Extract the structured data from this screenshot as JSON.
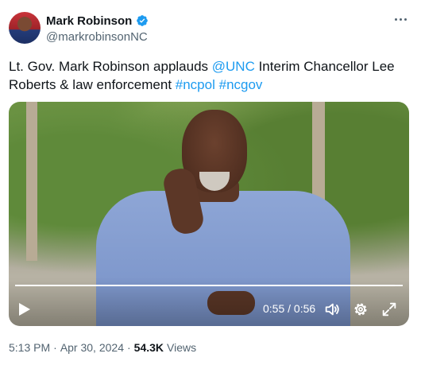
{
  "author": {
    "name": "Mark Robinson",
    "handle": "@markrobinsonNC",
    "verified": true
  },
  "tweet": {
    "text_1": "Lt. Gov. Mark Robinson applauds ",
    "mention": "@UNC",
    "text_2": " Interim Chancellor Lee Roberts & law enforcement ",
    "hashtag_1": "#ncpol",
    "hashtag_2": "#ncgov"
  },
  "video": {
    "current_time": "0:55",
    "separator": " / ",
    "duration": "0:56",
    "progress": 0.98,
    "controls": [
      "play-icon",
      "volume-icon",
      "settings-gear-icon",
      "fullscreen-icon"
    ]
  },
  "footer": {
    "time": "5:13 PM",
    "dot": "·",
    "date": "Apr 30, 2024",
    "dot2": "·",
    "views_count": "54.3K",
    "views_label": "Views"
  },
  "colors": {
    "link": "#1d9bf0",
    "text": "#0f1419",
    "secondary": "#536471"
  }
}
